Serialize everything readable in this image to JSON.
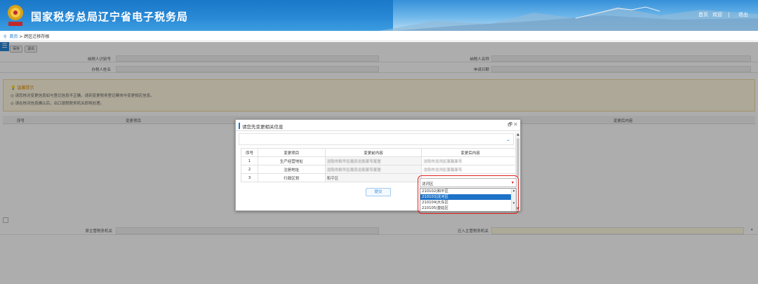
{
  "header": {
    "title": "国家税务总局辽宁省电子税务局",
    "links": [
      "首页",
      "欢迎",
      "退出"
    ]
  },
  "breadcrumb": {
    "home": "首页",
    "separator": ">",
    "current": "跨区迁移存根"
  },
  "toolbar": {
    "btn1": "保存",
    "btn2": "退出"
  },
  "form": {
    "taxpayer_id_label": "纳税人识别号",
    "taxpayer_name_label": "纳税人名称",
    "tax_agent_label": "办税人姓名",
    "apply_date_label": "申请日期"
  },
  "tips": {
    "title": "温馨提示",
    "line1": "请您核对变更信息如与登记信息不正确，请到变更税务登记模块中变更相应信息。",
    "line2": "请在核对信息确认后，出口退税税务机关即将处理。"
  },
  "grid": {
    "col_no": "序号",
    "col_item": "变更项目",
    "col_after": "变更后内容"
  },
  "bottom": {
    "original_authority_label": "原主管税务机关",
    "target_authority_label": "迁入主管税务机关"
  },
  "modal": {
    "title": "请您先变更相关信息",
    "headers": [
      "序号",
      "变更项目",
      "变更前内容",
      "变更后内容"
    ],
    "rows": [
      {
        "no": "1",
        "item": "生产经营地址",
        "before": "沈阳市和平区南京北街某号某室",
        "after": "沈阳市沈河区某路某号"
      },
      {
        "no": "2",
        "item": "注册地址",
        "before": "沈阳市和平区南京北街某号某室",
        "after": "沈阳市沈河区某路某号"
      },
      {
        "no": "3",
        "item": "行政区划",
        "before": "和平区",
        "after": "沈河区"
      }
    ],
    "submit_label": "提交"
  },
  "dropdown": {
    "selected": "沈河区",
    "options": [
      "210102|和平区",
      "210103|沈河区",
      "210104|大东区",
      "210105|皇姑区"
    ],
    "selected_index": 1
  },
  "colors": {
    "brand": "#1a78c8",
    "highlight": "#e02020",
    "option_selected": "#1e72c7"
  }
}
